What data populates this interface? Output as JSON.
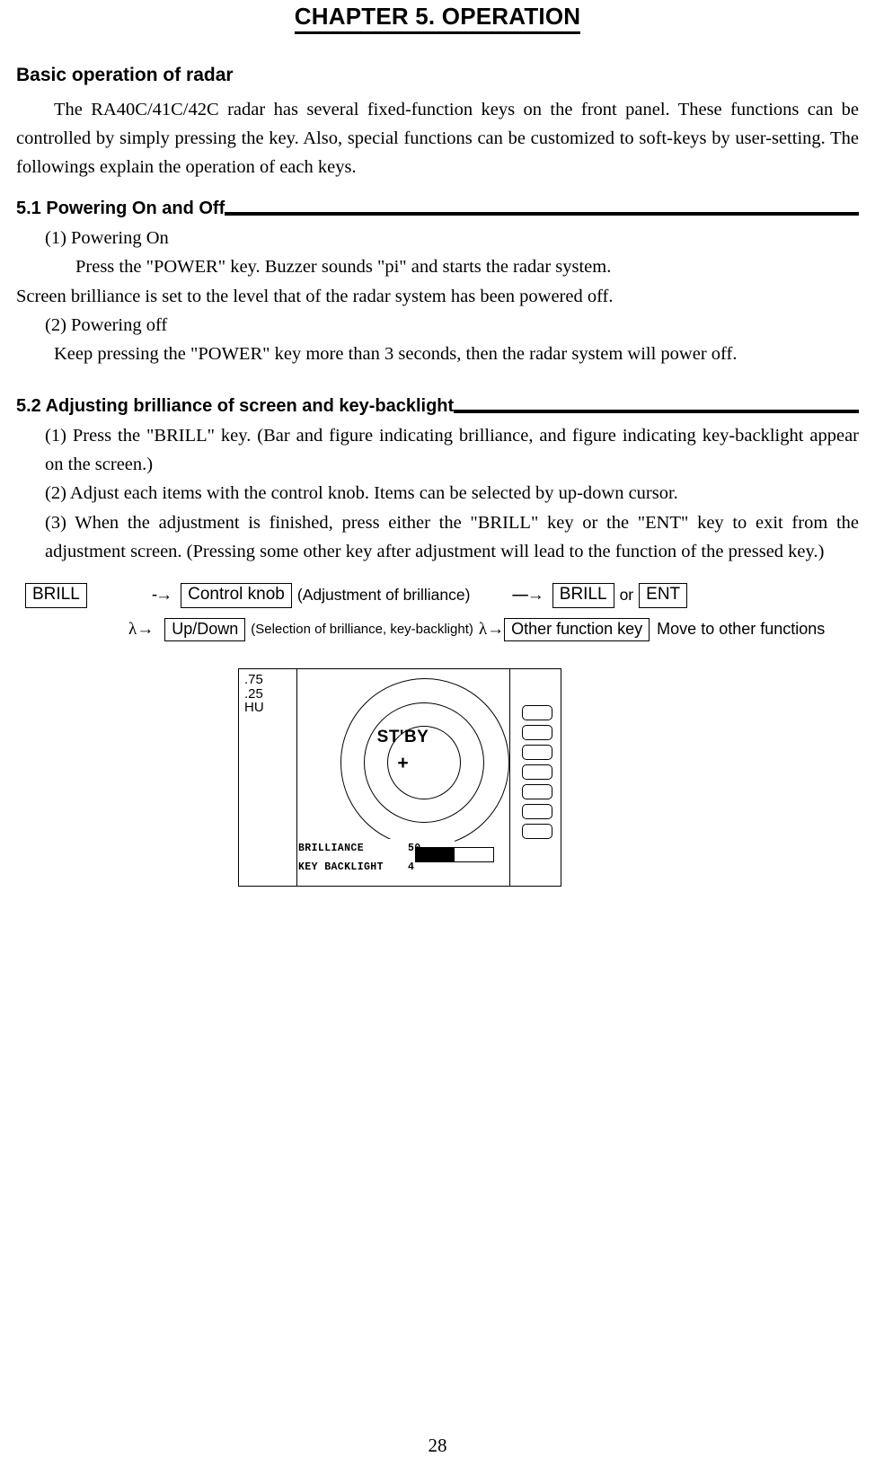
{
  "document": {
    "chapter_title": "CHAPTER 5.  OPERATION",
    "page_number": "28"
  },
  "intro": {
    "heading": "Basic operation of radar",
    "paragraph": "The RA40C/41C/42C radar has several fixed-function keys on the front panel. These functions can be controlled by simply pressing the key.  Also, special functions can be customized to soft-keys by user-setting.  The followings explain the operation of each keys."
  },
  "section_5_1": {
    "heading": "5.1 Powering On and Off",
    "item1_label": "(1)  Powering On",
    "item1_body": "Press the \"POWER\" key. Buzzer sounds \"pi\" and starts the radar system.",
    "item1_note": "Screen brilliance is set to the level that of the radar system has been powered off.",
    "item2_label": "(2)  Powering off",
    "item2_body": "Keep pressing the \"POWER\" key more than 3 seconds, then the radar system will power off."
  },
  "section_5_2": {
    "heading": "5.2 Adjusting brilliance of screen and key-backlight",
    "item1": "(1)  Press the \"BRILL\" key.  (Bar and figure indicating brilliance, and figure indicating key-backlight appear on the screen.)",
    "item2": "(2)  Adjust each items with the control knob. Items can be selected by up-down cursor.",
    "item3": "(3)  When the adjustment is finished, press either the \"BRILL\" key or the \"ENT\" key to exit from the adjustment screen.  (Pressing some other key after adjustment will lead to the function of the pressed key.)"
  },
  "key_flow": {
    "row1": {
      "start_key": "BRILL",
      "arrow1": "→",
      "knob_key": "Control knob",
      "knob_note": "(Adjustment of brilliance)",
      "arrow2": "→",
      "exit_key_1": "BRILL",
      "or_text": "or",
      "exit_key_2": "ENT"
    },
    "row2": {
      "branch_arrow": "λ→",
      "updown_key": "Up/Down",
      "updown_note": "(Selection of brilliance, key-backlight)",
      "branch_arrow2": "λ→",
      "other_key": "Other function key",
      "other_note": "Move to other functions"
    }
  },
  "radar_figure": {
    "range_labels": [
      ".75",
      ".25",
      "HU"
    ],
    "status_text": "ST'BY",
    "own_ship_marker": "+",
    "osd": [
      {
        "label": "BRILLIANCE",
        "value": "50"
      },
      {
        "label": "KEY BACKLIGHT",
        "value": "4"
      }
    ],
    "brilliance_bar_percent": 50,
    "softkey_count": 7
  }
}
